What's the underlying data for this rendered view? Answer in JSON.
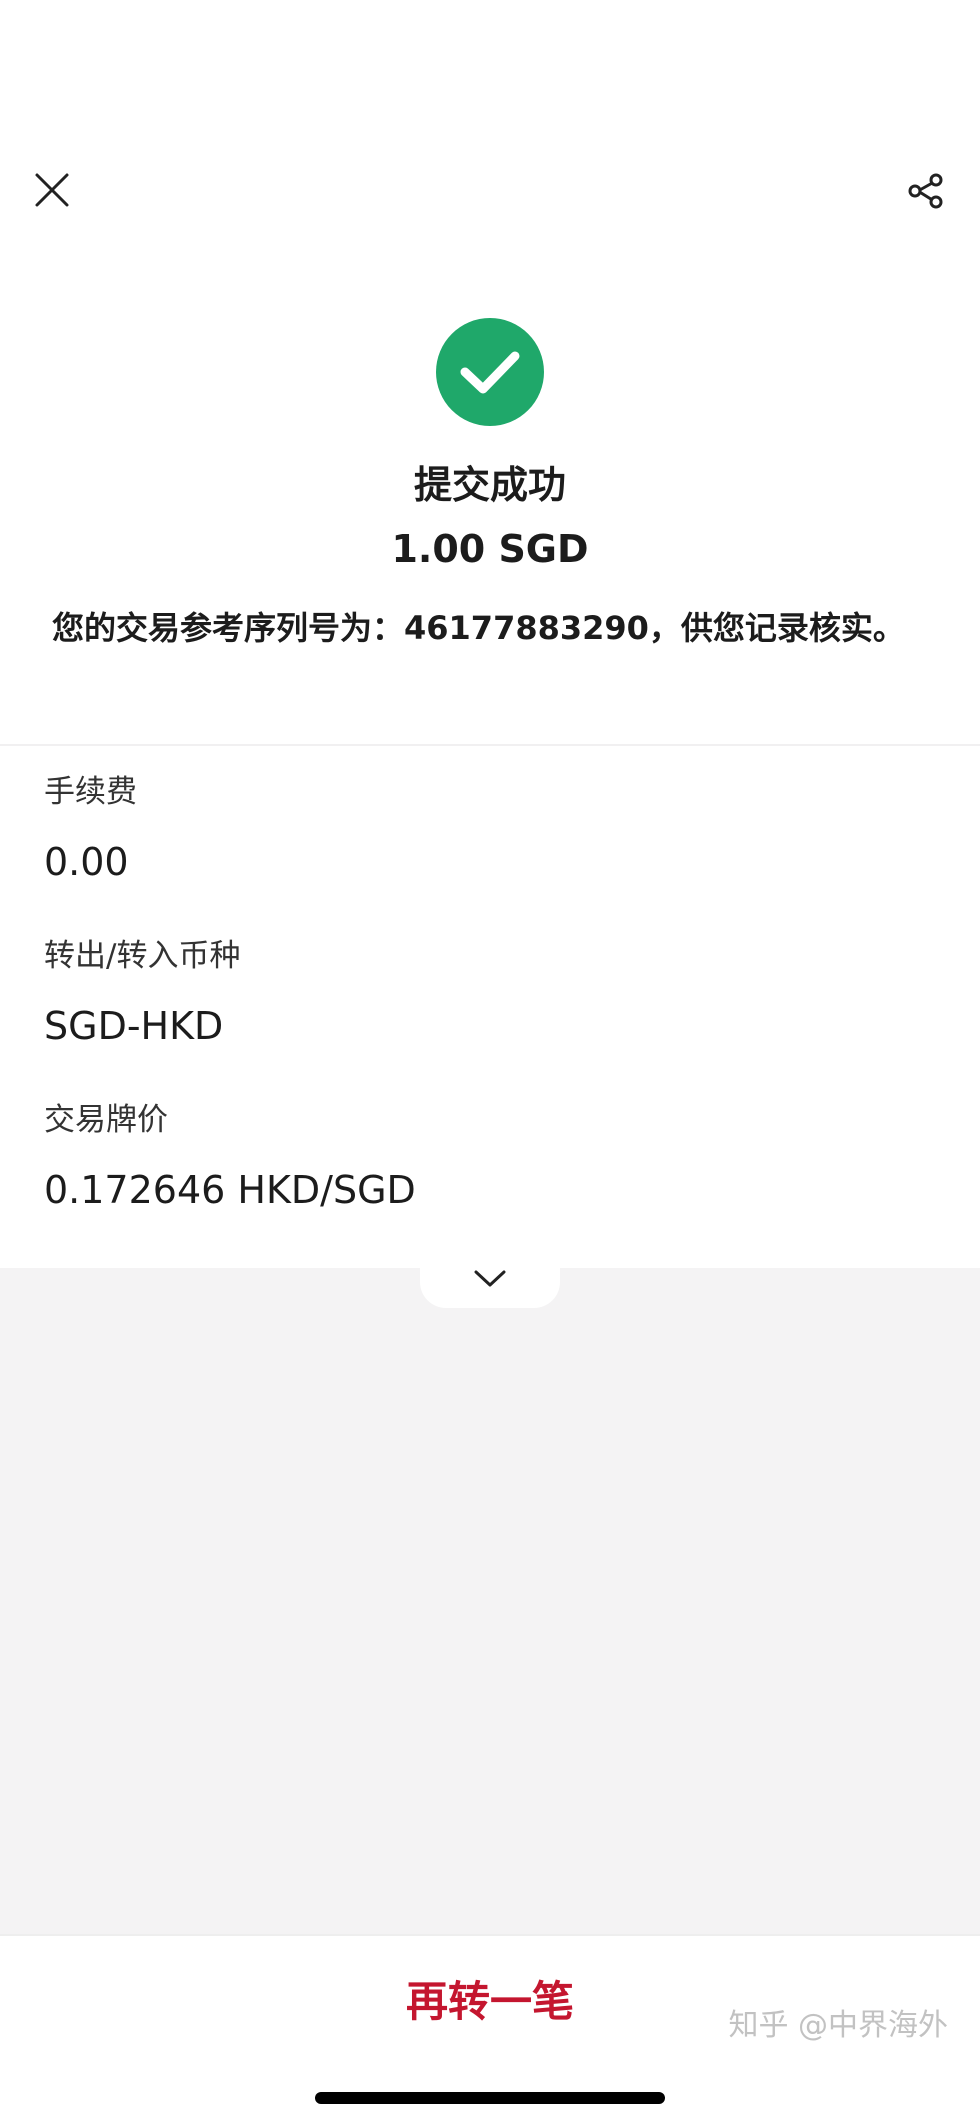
{
  "header": {
    "close_icon": "close-icon",
    "share_icon": "share-icon"
  },
  "success": {
    "icon": "check-circle-icon",
    "title": "提交成功",
    "amount": "1.00 SGD",
    "reference_text": "您的交易参考序列号为：46177883290，供您记录核实。"
  },
  "details": {
    "fee_label": "手续费",
    "fee_value": "0.00",
    "currency_label": "转出/转入币种",
    "currency_value": "SGD-HKD",
    "rate_label": "交易牌价",
    "rate_value": "0.172646 HKD/SGD",
    "expand_icon": "chevron-down-icon"
  },
  "actions": {
    "repeat_transfer_label": "再转一笔"
  },
  "watermark": {
    "text": "知乎 @中界海外"
  },
  "colors": {
    "success_green": "#1fa86a",
    "accent_red": "#c4162f",
    "page_gray": "#f4f3f4"
  }
}
